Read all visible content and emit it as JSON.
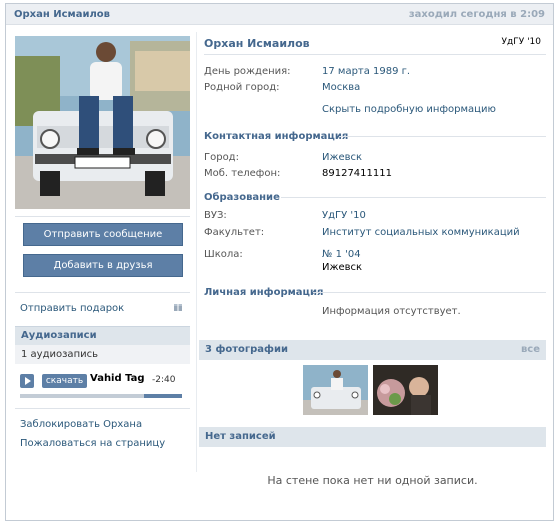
{
  "header": {
    "name": "Орхан Исмаилов",
    "last_seen": "заходил сегодня в 2:09"
  },
  "left": {
    "send_message": "Отправить сообщение",
    "add_friend": "Добавить в друзья",
    "send_gift": "Отправить подарок",
    "audio": {
      "title": "Аудиозаписи",
      "count": "1 аудиозапись",
      "download": "скачать",
      "track": "Vahid Tagi",
      "duration": "-2:40",
      "progress": 0.77
    },
    "block": "Заблокировать Орхана",
    "report": "Пожаловаться на страницу"
  },
  "profile": {
    "name": "Орхан Исмаилов",
    "school_tag": "УдГУ '10",
    "birthday_label": "День рождения:",
    "birthday": "17 марта 1989 г.",
    "hometown_label": "Родной город:",
    "hometown": "Москва",
    "hide_details": "Скрыть подробную информацию",
    "contact_title": "Контактная информация",
    "city_label": "Город:",
    "city": "Ижевск",
    "phone_label": "Моб. телефон:",
    "phone": "89127411111",
    "education_title": "Образование",
    "uni_label": "ВУЗ:",
    "uni": "УдГУ '10",
    "faculty_label": "Факультет:",
    "faculty": "Институт социальных коммуникаций",
    "school_label": "Школа:",
    "school": "№ 1 '04",
    "school_city": "Ижевск",
    "personal_title": "Личная информация",
    "personal_empty": "Информация отсутствует."
  },
  "photos": {
    "title": "3 фотографии",
    "all": "все"
  },
  "wall": {
    "title": "Нет записей",
    "empty": "На стене пока нет ни одной записи."
  },
  "colors": {
    "brand": "#45688e",
    "button": "#5d7fa6",
    "link": "#2b587a"
  }
}
